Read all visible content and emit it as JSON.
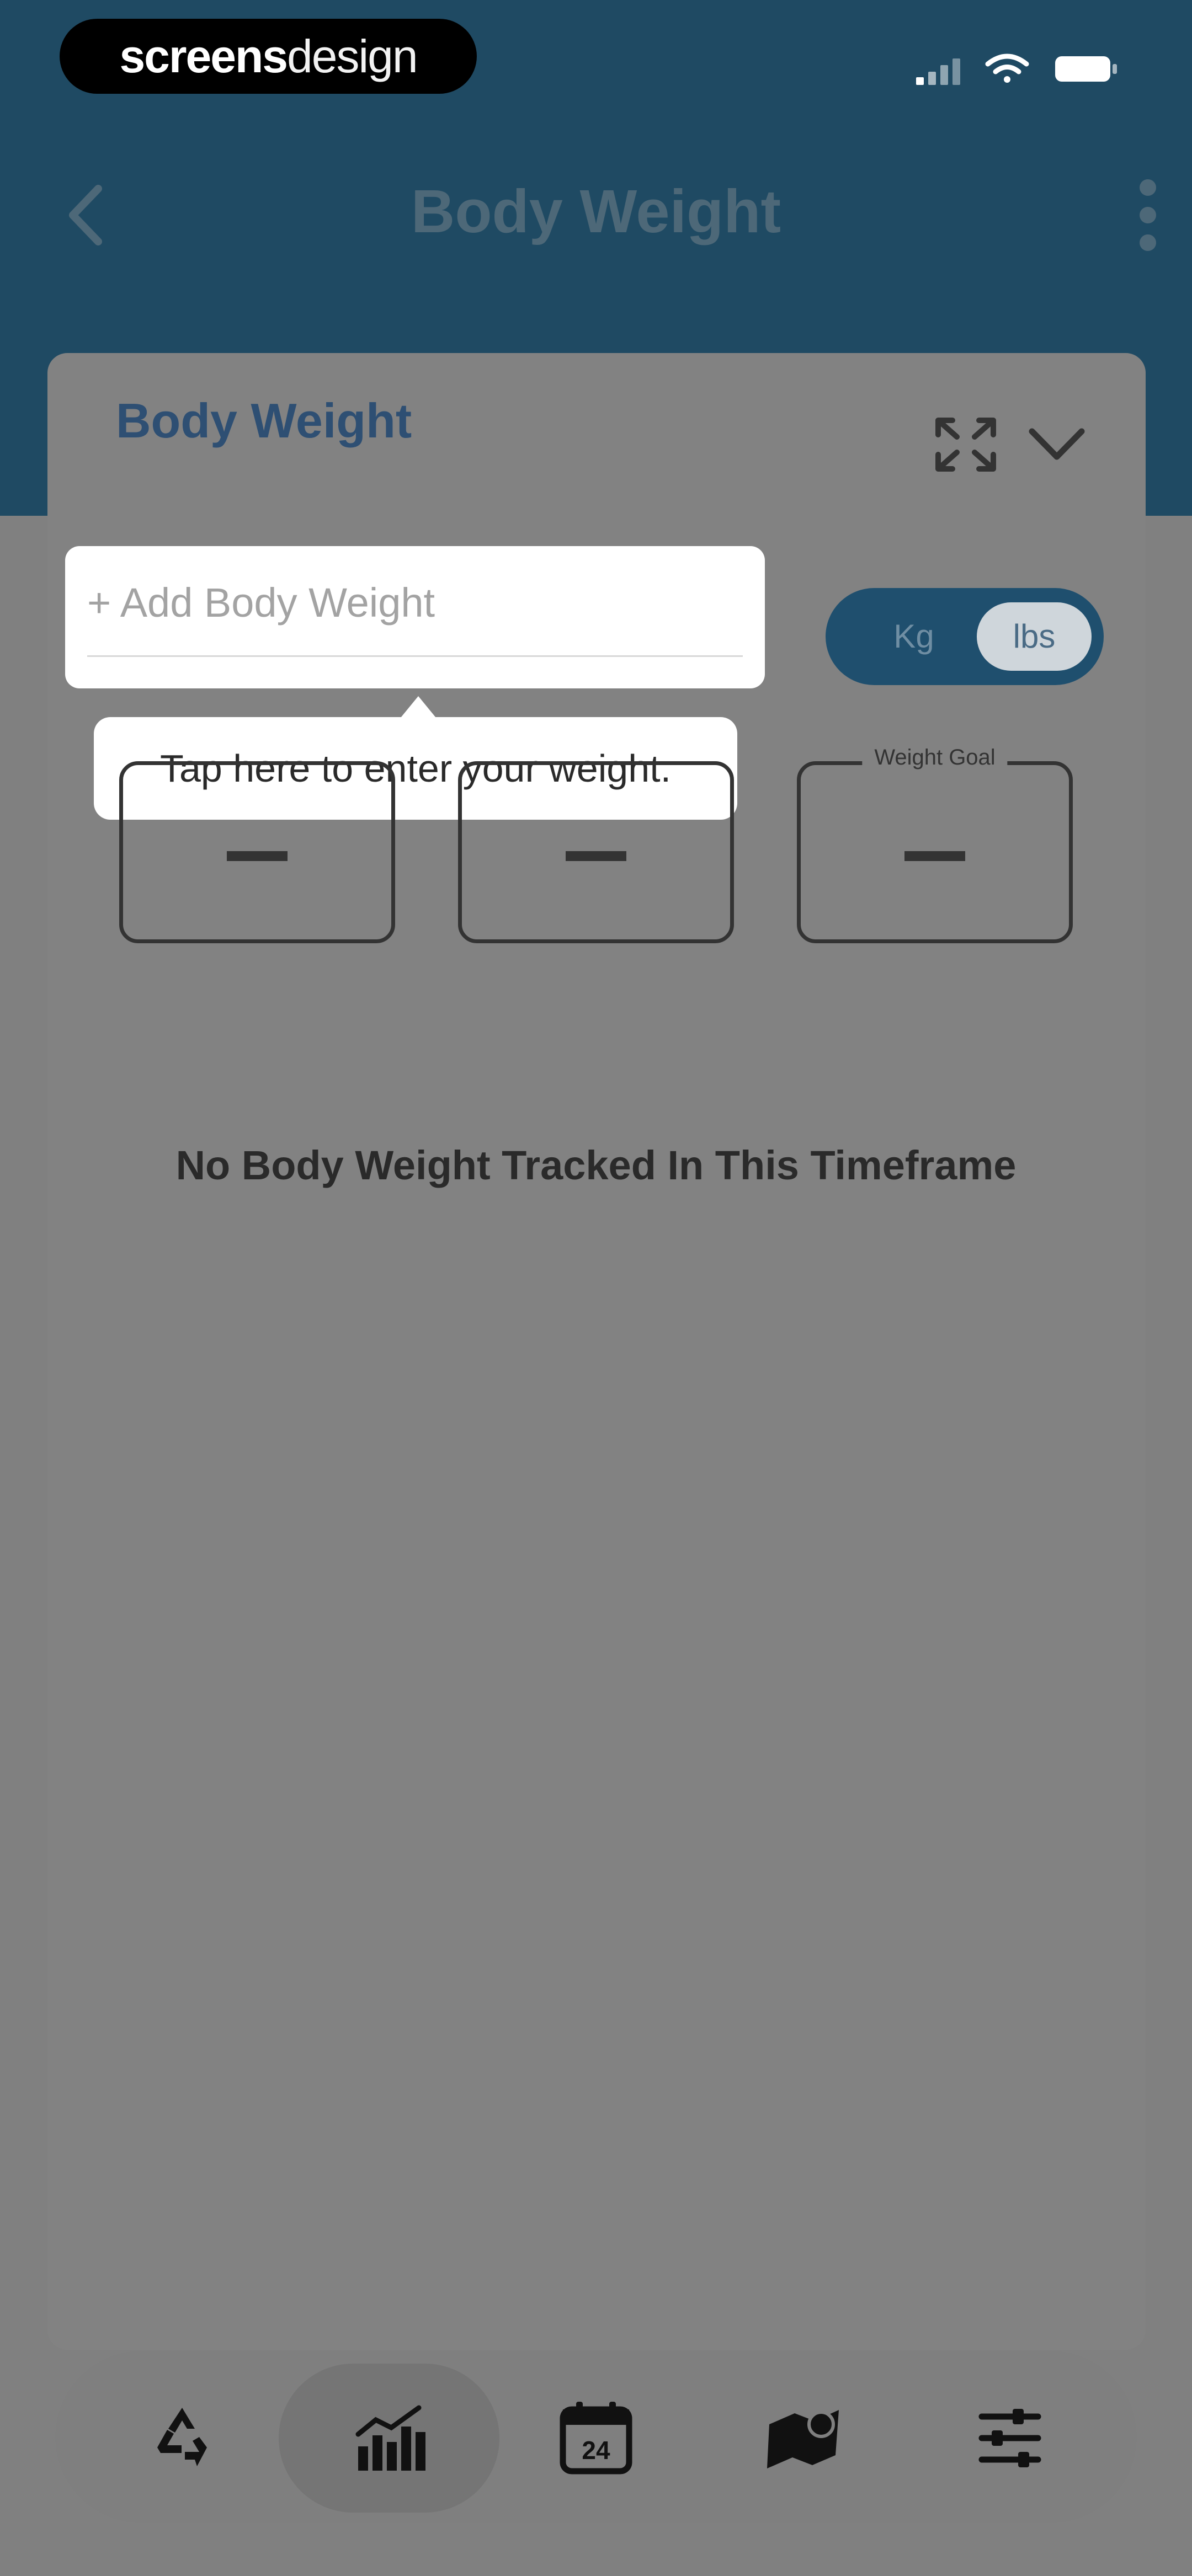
{
  "brand": {
    "part1": "screens",
    "part2": "design"
  },
  "header": {
    "title": "Body Weight"
  },
  "card": {
    "title": "Body Weight"
  },
  "add_field": {
    "placeholder": "+ Add Body Weight"
  },
  "tooltip": {
    "text": "Tap here to enter your weight."
  },
  "unit_toggle": {
    "options": [
      "Kg",
      "lbs"
    ],
    "selected": "lbs"
  },
  "stats": [
    {
      "label": "",
      "value": "—"
    },
    {
      "label": "",
      "value": "—"
    },
    {
      "label": "Weight Goal",
      "value": "—"
    }
  ],
  "empty_message": "No Body Weight Tracked In This Timeframe",
  "tabbar": {
    "items": [
      {
        "icon": "recycle-icon"
      },
      {
        "icon": "bar-chart-icon"
      },
      {
        "icon": "calendar-icon"
      },
      {
        "icon": "map-icon"
      },
      {
        "icon": "sliders-icon"
      }
    ],
    "active_index": 1,
    "calendar_day": "24"
  },
  "colors": {
    "header_bg": "#1f4a63",
    "overlay_bg": "#808080",
    "accent": "#2e4f73"
  }
}
